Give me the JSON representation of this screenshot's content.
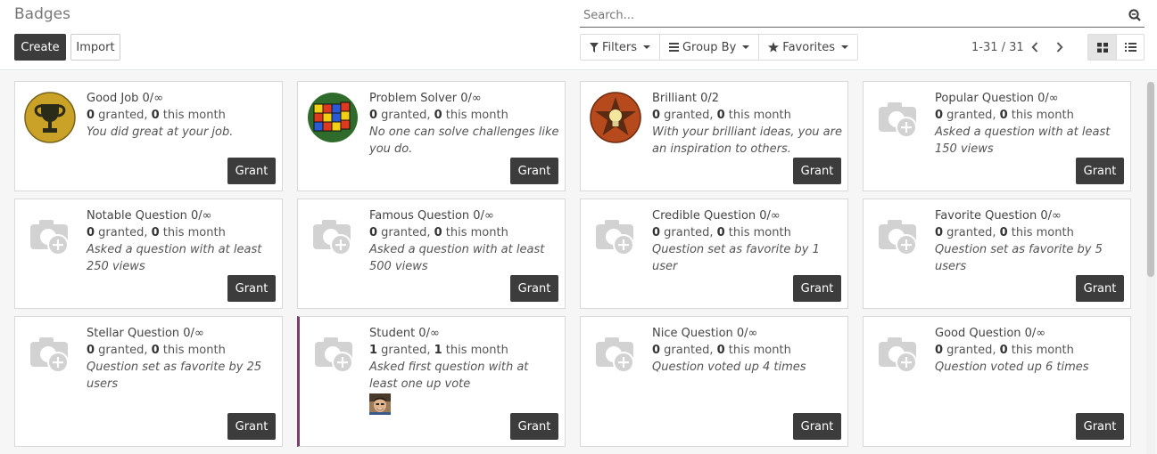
{
  "page": {
    "title": "Badges"
  },
  "toolbar": {
    "create_label": "Create",
    "import_label": "Import"
  },
  "search": {
    "placeholder": "Search..."
  },
  "filters": {
    "filters_label": "Filters",
    "groupby_label": "Group By",
    "favorites_label": "Favorites"
  },
  "pager": {
    "value": "1-31 / 31"
  },
  "icons": {
    "search": "search-icon",
    "filter": "filter-icon",
    "groupby": "list-icon",
    "favorites": "star-icon",
    "prev": "chevron-left-icon",
    "next": "chevron-right-icon",
    "kanban": "grid-icon",
    "list": "list-view-icon",
    "badge_placeholder": "camera-plus-icon"
  },
  "colors": {
    "accent": "#3c3c3c",
    "highlight_border": "#7c3e6d"
  },
  "cards": [
    {
      "name": "Good Job 0/∞",
      "granted": "0",
      "granted_label": " granted, ",
      "month": "0",
      "month_label": " this month",
      "desc": "You did great at your job.",
      "grant": "Grant"
    },
    {
      "name": "Problem Solver 0/∞",
      "granted": "0",
      "granted_label": " granted, ",
      "month": "0",
      "month_label": " this month",
      "desc": "No one can solve challenges like you do.",
      "grant": "Grant"
    },
    {
      "name": "Brilliant 0/2",
      "granted": "0",
      "granted_label": " granted, ",
      "month": "0",
      "month_label": " this month",
      "desc": "With your brilliant ideas, you are an inspiration to others.",
      "grant": "Grant"
    },
    {
      "name": "Popular Question 0/∞",
      "granted": "0",
      "granted_label": " granted, ",
      "month": "0",
      "month_label": " this month",
      "desc": "Asked a question with at least 150 views",
      "grant": "Grant"
    },
    {
      "name": "Notable Question 0/∞",
      "granted": "0",
      "granted_label": " granted, ",
      "month": "0",
      "month_label": " this month",
      "desc": "Asked a question with at least 250 views",
      "grant": "Grant"
    },
    {
      "name": "Famous Question 0/∞",
      "granted": "0",
      "granted_label": " granted, ",
      "month": "0",
      "month_label": " this month",
      "desc": "Asked a question with at least 500 views",
      "grant": "Grant"
    },
    {
      "name": "Credible Question 0/∞",
      "granted": "0",
      "granted_label": " granted, ",
      "month": "0",
      "month_label": " this month",
      "desc": "Question set as favorite by 1 user",
      "grant": "Grant"
    },
    {
      "name": "Favorite Question 0/∞",
      "granted": "0",
      "granted_label": " granted, ",
      "month": "0",
      "month_label": " this month",
      "desc": "Question set as favorite by 5 users",
      "grant": "Grant"
    },
    {
      "name": "Stellar Question 0/∞",
      "granted": "0",
      "granted_label": " granted, ",
      "month": "0",
      "month_label": " this month",
      "desc": "Question set as favorite by 25 users",
      "grant": "Grant"
    },
    {
      "name": "Student 0/∞",
      "granted": "1",
      "granted_label": " granted, ",
      "month": "1",
      "month_label": " this month",
      "desc": "Asked first question with at least one up vote",
      "grant": "Grant"
    },
    {
      "name": "Nice Question 0/∞",
      "granted": "0",
      "granted_label": " granted, ",
      "month": "0",
      "month_label": " this month",
      "desc": "Question voted up 4 times",
      "grant": "Grant"
    },
    {
      "name": "Good Question 0/∞",
      "granted": "0",
      "granted_label": " granted, ",
      "month": "0",
      "month_label": " this month",
      "desc": "Question voted up 6 times",
      "grant": "Grant"
    }
  ]
}
